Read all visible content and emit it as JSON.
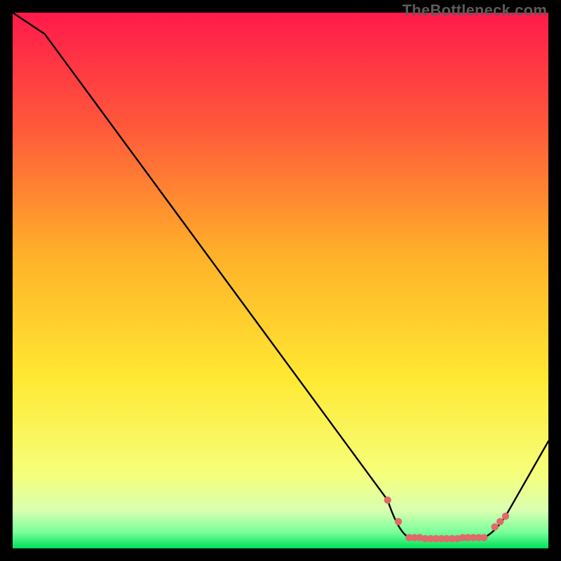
{
  "watermark": "TheBottleneck.com",
  "chart_data": {
    "type": "line",
    "title": "",
    "xlabel": "",
    "ylabel": "",
    "xlim": [
      0,
      100
    ],
    "ylim": [
      0,
      100
    ],
    "curve": {
      "name": "bottleneck-curve",
      "x": [
        0,
        6,
        70,
        74,
        88,
        92,
        100
      ],
      "y": [
        100,
        96,
        9,
        2,
        2,
        6,
        20
      ]
    },
    "markers": {
      "name": "highlighted-range",
      "x": [
        70,
        72,
        74,
        75,
        76,
        77,
        78,
        79,
        80,
        81,
        82,
        83,
        84,
        85,
        86,
        87,
        88,
        90,
        91,
        92
      ],
      "y": [
        9,
        5,
        2,
        2,
        2,
        1.8,
        1.8,
        1.8,
        1.8,
        1.8,
        1.8,
        1.8,
        2,
        2,
        2,
        2,
        2,
        4,
        5,
        6
      ]
    },
    "gradient_stops": [
      {
        "offset": 0.0,
        "color": "#ff1a4b"
      },
      {
        "offset": 0.22,
        "color": "#ff5b3a"
      },
      {
        "offset": 0.45,
        "color": "#ffb029"
      },
      {
        "offset": 0.68,
        "color": "#ffe832"
      },
      {
        "offset": 0.86,
        "color": "#f6ff7a"
      },
      {
        "offset": 0.93,
        "color": "#d8ffb0"
      },
      {
        "offset": 0.97,
        "color": "#79ff9a"
      },
      {
        "offset": 1.0,
        "color": "#00e05a"
      }
    ]
  }
}
